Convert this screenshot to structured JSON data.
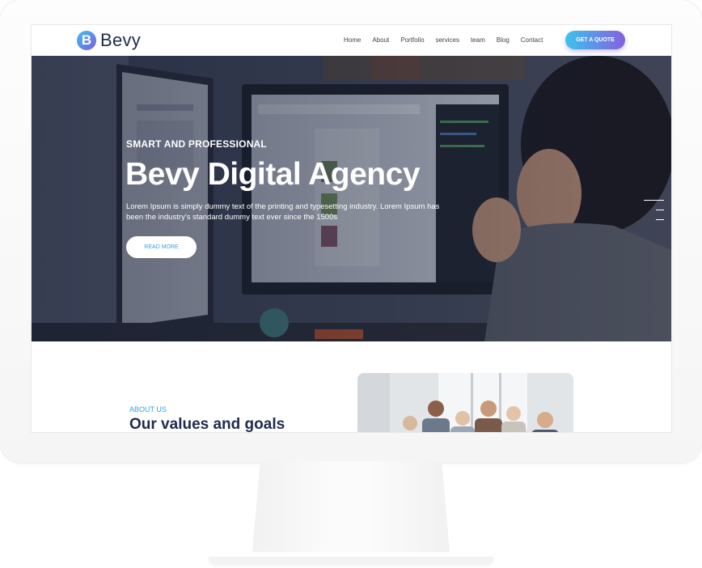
{
  "brand": {
    "logo_letter": "B",
    "name": "Bevy"
  },
  "nav": {
    "links": [
      "Home",
      "About",
      "Portfolio",
      "services",
      "team",
      "Blog",
      "Contact"
    ],
    "cta": "GET A QUOTE"
  },
  "hero": {
    "eyebrow": "SMART AND PROFESSIONAL",
    "title": "Bevy Digital Agency",
    "description": "Lorem Ipsum is simply dummy text of the printing and typesetting industry. Lorem Ipsum has been the industry's standard dummy text ever since the 1500s",
    "button": "READ MORE"
  },
  "about": {
    "eyebrow": "ABOUT US",
    "title": "Our values and goals"
  },
  "colors": {
    "accent_start": "#3ec2ec",
    "accent_end": "#8361e0",
    "heading": "#1f2a4d",
    "link_blue": "#2aa4e0"
  }
}
